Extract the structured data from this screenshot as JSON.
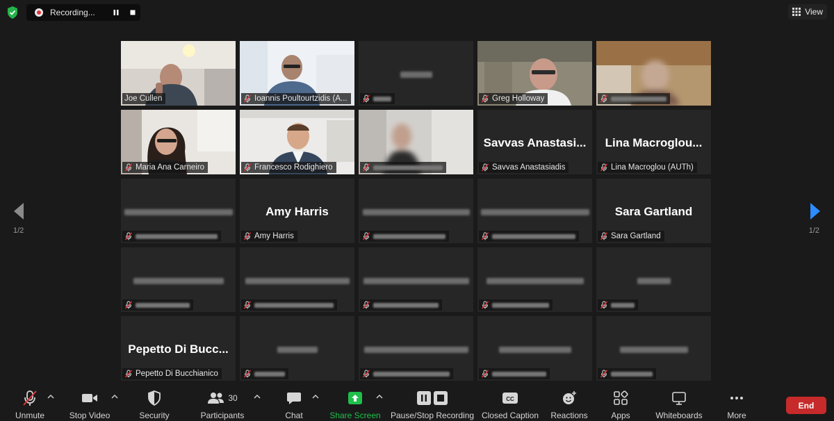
{
  "recording": {
    "label": "Recording..."
  },
  "view": {
    "label": "View"
  },
  "pagination": {
    "left": "1/2",
    "right": "1/2"
  },
  "tiles": [
    {
      "type": "video",
      "label": "Joe Cullen",
      "active": true,
      "muted": false,
      "scene": "A"
    },
    {
      "type": "video",
      "label": "Ioannis Poultourtzidis (A...",
      "muted": true,
      "scene": "B"
    },
    {
      "type": "blurred",
      "muted": true,
      "bw": 46,
      "lw": 26
    },
    {
      "type": "video",
      "label": "Greg Holloway",
      "muted": true,
      "scene": "C"
    },
    {
      "type": "video",
      "blurredLabel": true,
      "muted": true,
      "lw": 80,
      "scene": "D"
    },
    {
      "type": "video",
      "label": "Maria Ana Carneiro",
      "muted": true,
      "scene": "E"
    },
    {
      "type": "video",
      "label": "Francesco Rodighiero",
      "muted": true,
      "scene": "F"
    },
    {
      "type": "video",
      "blurredLabel": true,
      "muted": true,
      "lw": 100,
      "scene": "G"
    },
    {
      "type": "name",
      "big": "Savvas  Anastasi...",
      "label": "Savvas Anastasiadis",
      "muted": true
    },
    {
      "type": "name",
      "big": "Lina  Macroglou...",
      "label": "Lina Macroglou (AUTh)",
      "muted": true
    },
    {
      "type": "blurred",
      "muted": true,
      "bw": 156,
      "lw": 118
    },
    {
      "type": "name",
      "big": "Amy Harris",
      "label": "Amy Harris",
      "muted": true
    },
    {
      "type": "blurred",
      "muted": true,
      "bw": 154,
      "lw": 104
    },
    {
      "type": "blurred",
      "muted": true,
      "bw": 156,
      "lw": 120
    },
    {
      "type": "name",
      "big": "Sara Gartland",
      "label": "Sara Gartland",
      "muted": true
    },
    {
      "type": "blurred",
      "muted": true,
      "bw": 130,
      "lw": 78
    },
    {
      "type": "blurred",
      "muted": true,
      "bw": 150,
      "lw": 114
    },
    {
      "type": "blurred",
      "muted": true,
      "bw": 152,
      "lw": 94
    },
    {
      "type": "blurred",
      "muted": true,
      "bw": 140,
      "lw": 82
    },
    {
      "type": "blurred",
      "muted": true,
      "bw": 48,
      "lw": 34
    },
    {
      "type": "name",
      "big": "Pepetto Di Bucc...",
      "label": "Pepetto Di Bucchianico",
      "muted": true
    },
    {
      "type": "blurred",
      "muted": true,
      "bw": 58,
      "lw": 44
    },
    {
      "type": "blurred",
      "muted": true,
      "bw": 150,
      "lw": 110
    },
    {
      "type": "blurred",
      "muted": true,
      "bw": 104,
      "lw": 78
    },
    {
      "type": "blurred",
      "muted": true,
      "bw": 98,
      "lw": 60
    }
  ],
  "toolbar": {
    "unmute": "Unmute",
    "stop_video": "Stop Video",
    "security": "Security",
    "participants": "Participants",
    "participants_count": "30",
    "chat": "Chat",
    "share_screen": "Share Screen",
    "pause_stop_recording": "Pause/Stop Recording",
    "closed_caption": "Closed Caption",
    "reactions": "Reactions",
    "apps": "Apps",
    "whiteboards": "Whiteboards",
    "more": "More",
    "end": "End"
  },
  "colors": {
    "active_speaker": "#c6d35a",
    "end_button": "#c62a2a",
    "share_green": "#1fbf4b",
    "mute_red": "#e0353b",
    "nav_blue": "#2d8cff"
  }
}
